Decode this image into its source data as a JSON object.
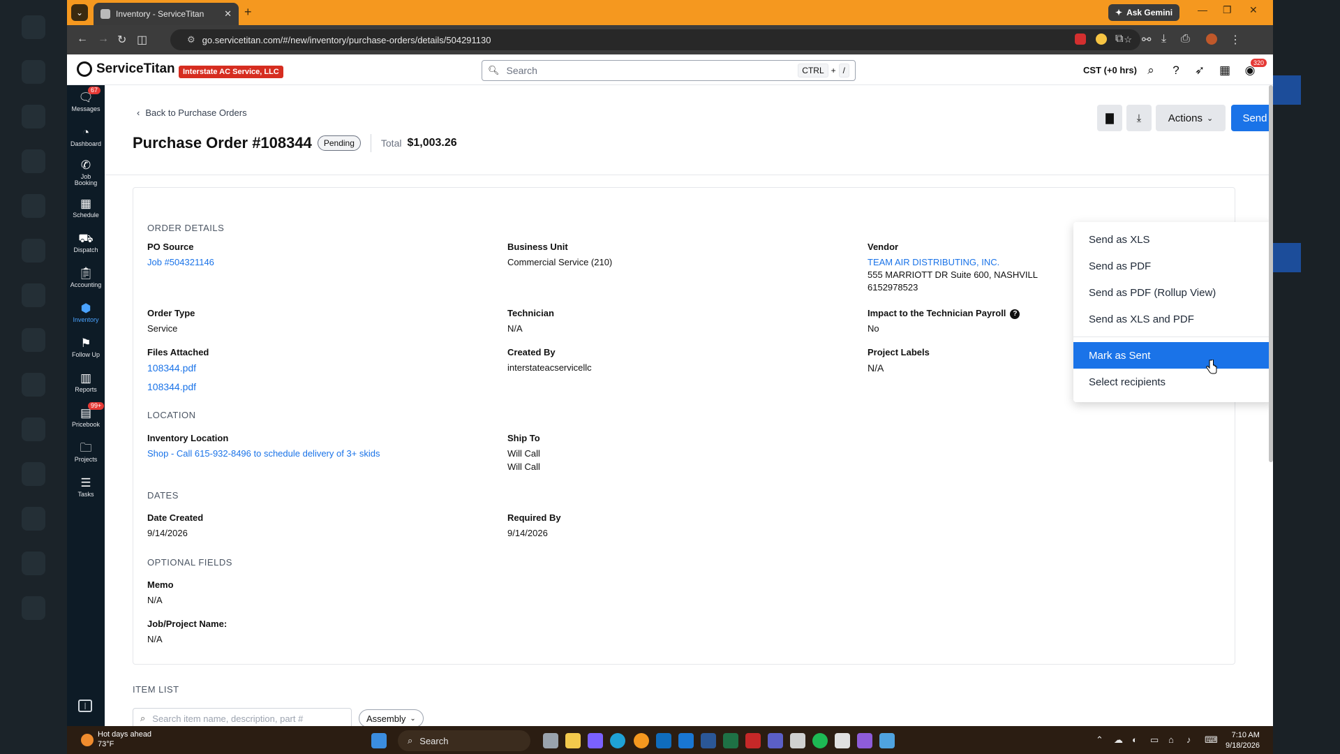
{
  "browser": {
    "tab_title": "Inventory - ServiceTitan",
    "new_tab": "+",
    "ask_gemini": "Ask Gemini",
    "url": "go.servicetitan.com/#/new/inventory/purchase-orders/details/504291130"
  },
  "app": {
    "logo_text": "ServiceTitan",
    "company": "Interstate AC Service, LLC",
    "search_placeholder": "Search",
    "kbd_ctrl": "CTRL",
    "kbd_plus": "+",
    "kbd_slash": "/",
    "timezone": "CST (+0 hrs)",
    "user_badge": "320"
  },
  "sidenav": {
    "items": [
      {
        "label": "Messages",
        "icon": "message-icon",
        "badge": "67"
      },
      {
        "label": "Dashboard",
        "icon": "dashboard-icon"
      },
      {
        "label": "Job Booking",
        "icon": "phone-icon"
      },
      {
        "label": "Schedule",
        "icon": "calendar-icon"
      },
      {
        "label": "Dispatch",
        "icon": "truck-icon"
      },
      {
        "label": "Accounting",
        "icon": "clipboard-icon"
      },
      {
        "label": "Inventory",
        "icon": "cube-icon",
        "active": true
      },
      {
        "label": "Follow Up",
        "icon": "flag-icon"
      },
      {
        "label": "Reports",
        "icon": "bar-chart-icon"
      },
      {
        "label": "Pricebook",
        "icon": "book-icon",
        "badge": "99+"
      },
      {
        "label": "Projects",
        "icon": "folder-icon"
      },
      {
        "label": "Tasks",
        "icon": "task-list-icon"
      }
    ]
  },
  "page": {
    "back_link": "Back to Purchase Orders",
    "title": "Purchase Order #108344",
    "status": "Pending",
    "total_label": "Total",
    "total_value": "$1,003.26",
    "actions_label": "Actions",
    "send_as_label": "Send As"
  },
  "dropdown": {
    "items": [
      "Send as XLS",
      "Send as PDF",
      "Send as PDF (Rollup View)",
      "Send as XLS and PDF",
      "Mark as Sent",
      "Select recipients"
    ],
    "highlighted": "Mark as Sent"
  },
  "order_details": {
    "section_title": "ORDER DETAILS",
    "po_source_label": "PO Source",
    "po_source_value": "Job #504321146",
    "business_unit_label": "Business Unit",
    "business_unit_value": "Commercial Service (210)",
    "vendor_label": "Vendor",
    "vendor_name": "TEAM AIR DISTRIBUTING, INC.",
    "vendor_address": "555 MARRIOTT DR Suite 600, NASHVILL",
    "vendor_phone": "6152978523",
    "order_type_label": "Order Type",
    "order_type_value": "Service",
    "technician_label": "Technician",
    "technician_value": "N/A",
    "impact_label": "Impact to the Technician Payroll",
    "impact_value": "No",
    "files_label": "Files Attached",
    "files": [
      "108344.pdf",
      "108344.pdf"
    ],
    "created_by_label": "Created By",
    "created_by_value": "interstateacservicellc",
    "project_labels_label": "Project Labels",
    "project_labels_value": "N/A"
  },
  "location": {
    "section_title": "LOCATION",
    "inventory_location_label": "Inventory Location",
    "inventory_location_value": "Shop - Call 615-932-8496 to schedule delivery of 3+ skids",
    "ship_to_label": "Ship To",
    "ship_to_line1": "Will Call",
    "ship_to_line2": "Will Call"
  },
  "dates": {
    "section_title": "DATES",
    "date_created_label": "Date Created",
    "date_created_value": "9/14/2026",
    "required_by_label": "Required By",
    "required_by_value": "9/14/2026"
  },
  "optional_fields": {
    "section_title": "OPTIONAL FIELDS",
    "memo_label": "Memo",
    "memo_value": "N/A",
    "job_project_label": "Job/Project Name:",
    "job_project_value": "N/A"
  },
  "item_list": {
    "section_title": "ITEM LIST",
    "search_placeholder": "Search item name, description, part #",
    "assembly_filter": "Assembly"
  },
  "taskbar": {
    "weather_title": "Hot days ahead",
    "weather_temp": "73°F",
    "search_label": "Search",
    "time": "7:10 AM",
    "date": "9/18/2026"
  },
  "colors": {
    "accent_blue": "#1a73e8",
    "chrome_orange": "#f5981f",
    "nav_dark": "#0d1b26",
    "company_red": "#d62d20"
  }
}
